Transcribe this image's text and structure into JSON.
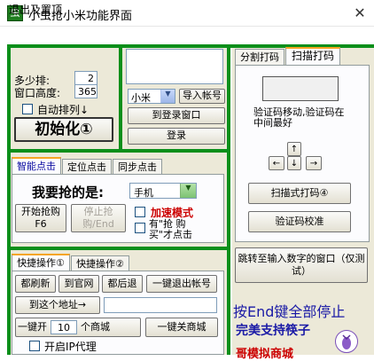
{
  "window": {
    "title": "小虫抢小米功能界面",
    "close_glyph": "✕",
    "icon_glyph": "虫"
  },
  "menu": {
    "exit_hide": "退出及置顶"
  },
  "left_top": {
    "rows_label": "多少排:",
    "rows_value": "2",
    "height_label": "窗口高度:",
    "height_value": "365",
    "auto_arrange_label": "自动排列↓",
    "init_button": "初始化①"
  },
  "login": {
    "account_select": "小米",
    "import_button": "导入帐号",
    "goto_login_button": "到登录窗口",
    "login_button": "登录"
  },
  "click_tabs": {
    "tabs": [
      "智能点击",
      "定位点击",
      "同步点击"
    ],
    "want_label": "我要抢的是:",
    "product_select": "手机",
    "start_button": "开始抢购F6",
    "stop_button": "停止抢购/End",
    "accelerate_label": "加速模式",
    "hint_label": "有\"抢 购买\"才点击"
  },
  "quick_tabs": {
    "tabs": [
      "快捷操作①",
      "快捷操作②"
    ],
    "refresh_button": "都刷新",
    "official_button": "到官网",
    "back_button": "都后退",
    "logout_button": "一键退出帐号",
    "goto_address_button": "到这个地址→",
    "address_value": "",
    "open_prefix": "一键开",
    "open_count": "10",
    "open_suffix": "个商城",
    "close_mall_button": "一键关商城",
    "proxy_label": "开启IP代理"
  },
  "captcha_tabs": {
    "tabs": [
      "分割打码",
      "扫描打码"
    ],
    "hint_text": "验证码移动,验证码在中间最好",
    "arrow_up": "↑",
    "arrow_left": "←",
    "arrow_down": "↓",
    "arrow_right": "→",
    "scan_button": "扫描式打码④",
    "calibrate_button": "验证码校准",
    "jump_button": "跳转至输入数字的窗口（仅测试）"
  },
  "footer": {
    "end_hint": "按End键全部停止",
    "support_text": "完美支持筷子",
    "mall_text": "哥模拟商城"
  },
  "colors": {
    "frame_green": "#0a8f1a",
    "blue_text": "#1a1aa6",
    "red_text": "#cc0000"
  }
}
